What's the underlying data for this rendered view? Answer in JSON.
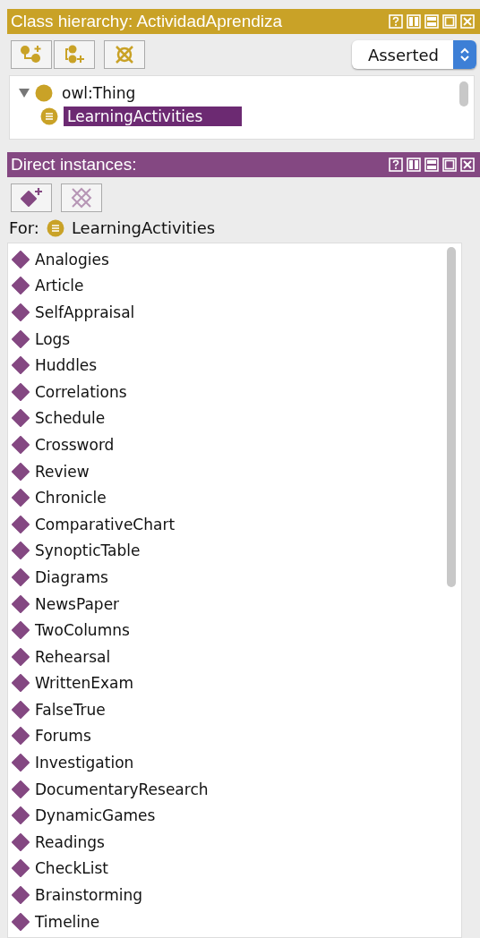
{
  "hierarchy_panel": {
    "title": "Class hierarchy: ActividadAprendiza",
    "view_selector": {
      "value": "Asserted"
    },
    "tree": [
      {
        "label": "owl:Thing",
        "expanded": true,
        "selected": false,
        "children": [
          {
            "label": "LearningActivities",
            "selected": true
          }
        ]
      }
    ]
  },
  "instances_panel": {
    "title": "Direct instances:",
    "for_label": "For:",
    "for_class": "LearningActivities",
    "instances": [
      {
        "label": "Analogies"
      },
      {
        "label": "Article"
      },
      {
        "label": "SelfAppraisal"
      },
      {
        "label": "Logs"
      },
      {
        "label": "Huddles"
      },
      {
        "label": "Correlations"
      },
      {
        "label": "Schedule"
      },
      {
        "label": "Crossword"
      },
      {
        "label": "Review"
      },
      {
        "label": "Chronicle"
      },
      {
        "label": "ComparativeChart"
      },
      {
        "label": "SynopticTable"
      },
      {
        "label": "Diagrams"
      },
      {
        "label": "NewsPaper"
      },
      {
        "label": "TwoColumns"
      },
      {
        "label": "Rehearsal"
      },
      {
        "label": "WrittenExam"
      },
      {
        "label": "FalseTrue"
      },
      {
        "label": "Forums"
      },
      {
        "label": "Investigation"
      },
      {
        "label": "DocumentaryResearch"
      },
      {
        "label": "DynamicGames"
      },
      {
        "label": "Readings"
      },
      {
        "label": "CheckList"
      },
      {
        "label": "Brainstorming"
      },
      {
        "label": "Timeline"
      }
    ]
  }
}
